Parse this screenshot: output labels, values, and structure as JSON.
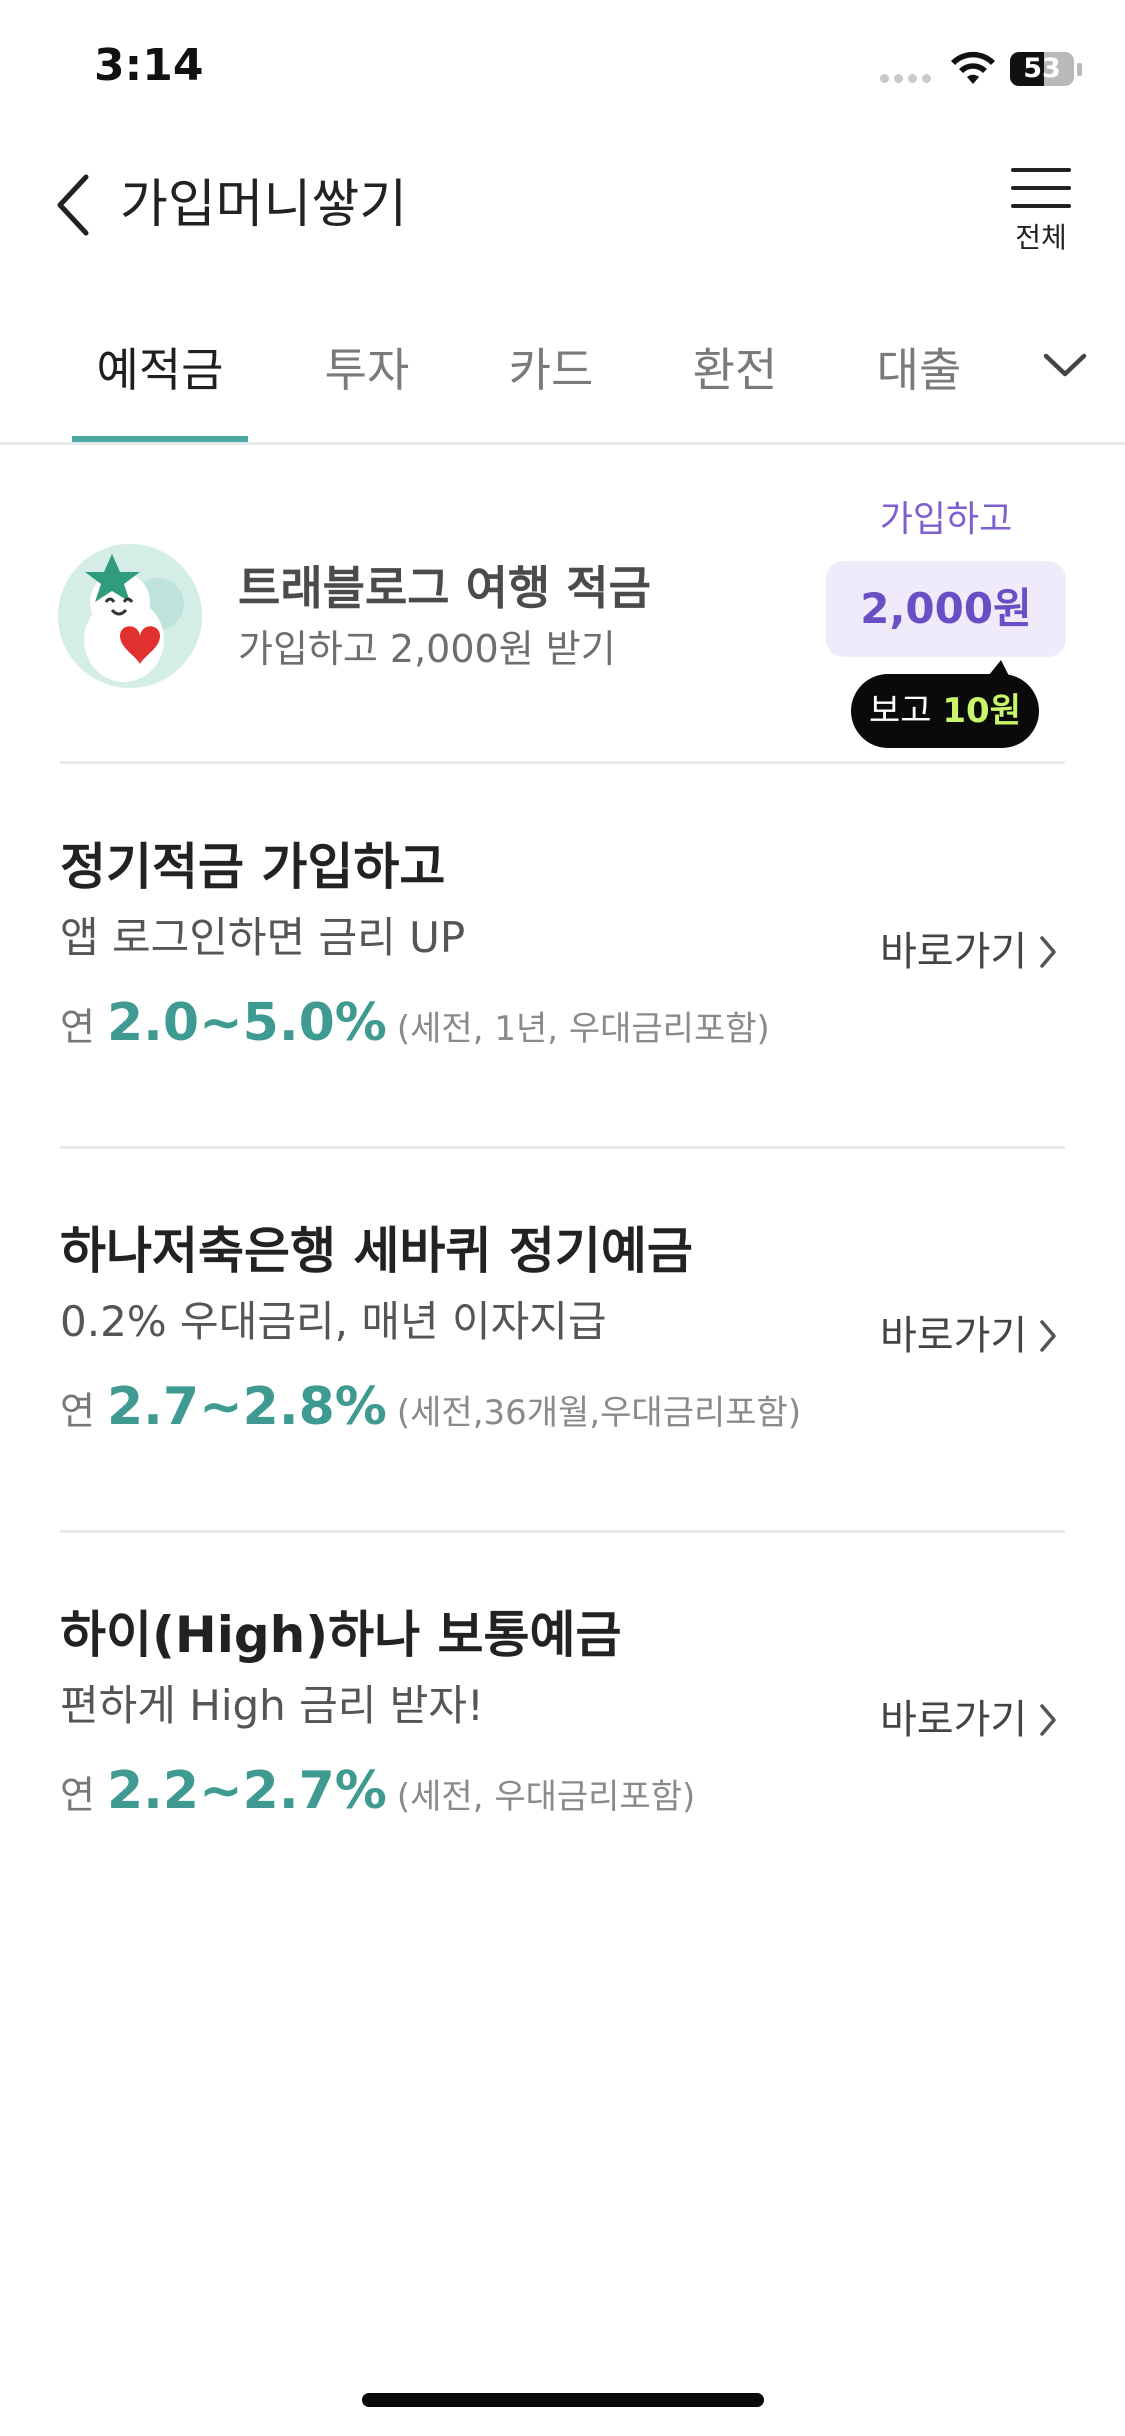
{
  "status_bar": {
    "time": "3:14",
    "battery": "53",
    "battery_level": 0.53
  },
  "header": {
    "title": "가입머니쌓기",
    "menu_label": "전체"
  },
  "tabs": [
    {
      "label": "예적금",
      "active": true
    },
    {
      "label": "투자",
      "active": false
    },
    {
      "label": "카드",
      "active": false
    },
    {
      "label": "환전",
      "active": false
    },
    {
      "label": "대출",
      "active": false
    }
  ],
  "promo": {
    "title": "트래블로그 여행 적금",
    "subtitle": "가입하고 2,000원 받기",
    "cta_label": "가입하고",
    "amount": "2,000원",
    "reward_prefix": "보고",
    "reward_amount": "10원"
  },
  "products": [
    {
      "title": "정기적금 가입하고",
      "description": "앱 로그인하면 금리 UP",
      "rate_prefix": "연",
      "rate": "2.0~5.0%",
      "rate_note": "(세전, 1년, 우대금리포함)",
      "link": "바로가기"
    },
    {
      "title": "하나저축은행 세바퀴 정기예금",
      "description": "0.2% 우대금리, 매년 이자지급",
      "rate_prefix": "연",
      "rate": "2.7~2.8%",
      "rate_note": "(세전,36개월,우대금리포함)",
      "link": "바로가기"
    },
    {
      "title": "하이(High)하나 보통예금",
      "description": "편하게 High 금리 받자!",
      "rate_prefix": "연",
      "rate": "2.2~2.7%",
      "rate_note": "(세전, 우대금리포함)",
      "link": "바로가기"
    }
  ],
  "colors": {
    "accent_teal": "#3f9b92",
    "accent_purple": "#6a4fc4",
    "reward_green": "#c9f56a"
  }
}
